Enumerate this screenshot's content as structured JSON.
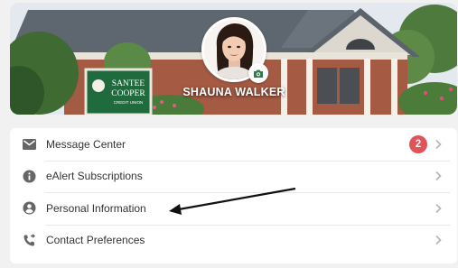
{
  "profile": {
    "name": "SHAUNA WALKER",
    "camera_icon": "camera-icon",
    "building_sign": [
      "SANTEE",
      "COOPER",
      "CREDIT UNION"
    ]
  },
  "menu": {
    "items": [
      {
        "label": "Message Center",
        "icon": "mail-icon",
        "badge": "2"
      },
      {
        "label": "eAlert Subscriptions",
        "icon": "info-icon"
      },
      {
        "label": "Personal Information",
        "icon": "account-circle-icon"
      },
      {
        "label": "Contact Preferences",
        "icon": "phone-forward-icon"
      }
    ],
    "chevron_icon": "chevron-right-icon"
  },
  "colors": {
    "badge": "#e25357",
    "icon": "#666666",
    "camera": "#2e7d4f",
    "background": "#f1f1f2"
  }
}
